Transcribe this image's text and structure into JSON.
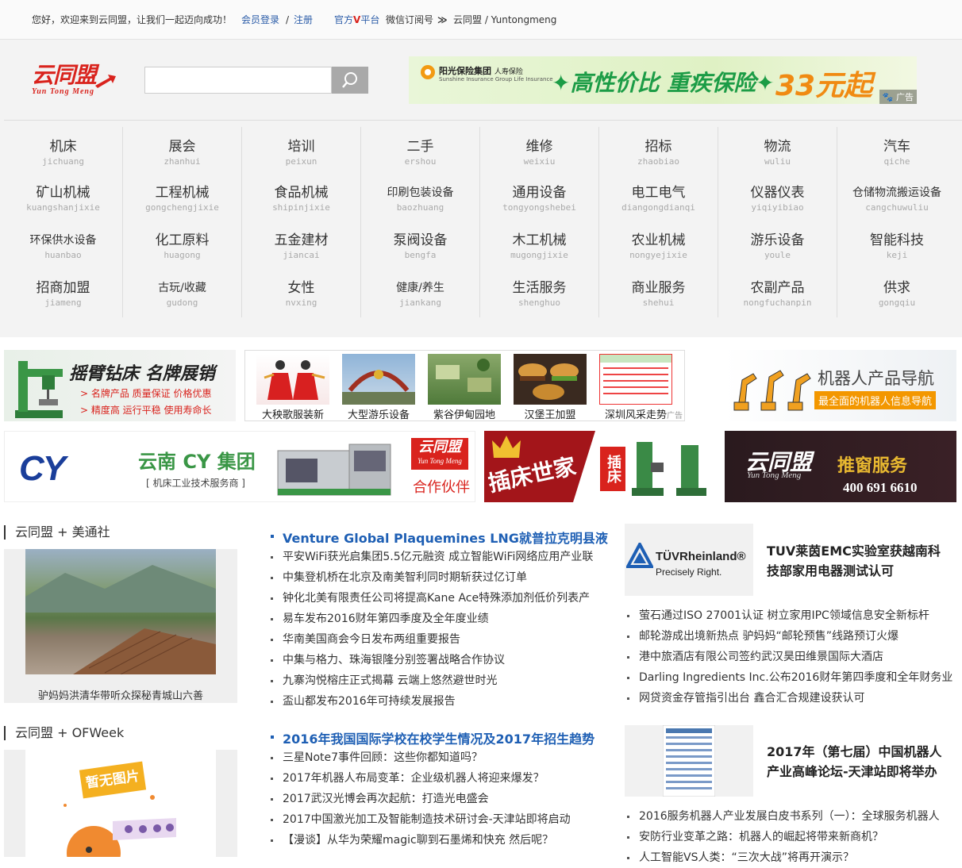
{
  "topbar": {
    "welcome": "您好，欢迎来到云同盟，让我们一起迈向成功！",
    "login": "会员登录",
    "sep": "/",
    "register": "注册",
    "official_prefix": "官方",
    "official_v": "V",
    "official_suffix": "平台",
    "wechat": "微信订阅号",
    "arrows": "≫",
    "brand": "云同盟 / Yuntongmeng"
  },
  "logo": {
    "cn": "云同盟",
    "en": "Yun Tong Meng"
  },
  "search": {
    "placeholder": "",
    "value": ""
  },
  "top_ad": {
    "company": "阳光保险集团",
    "company_sub": "人寿保险",
    "company_en": "Sunshine Insurance Group   Life Insurance",
    "slogan": "✦高性价比 重疾保险✦",
    "price": "33元起",
    "tag": "广告"
  },
  "nav": [
    [
      {
        "cn": "机床",
        "py": "jichuang"
      },
      {
        "cn": "展会",
        "py": "zhanhui"
      },
      {
        "cn": "培训",
        "py": "peixun"
      },
      {
        "cn": "二手",
        "py": "ershou"
      },
      {
        "cn": "维修",
        "py": "weixiu"
      },
      {
        "cn": "招标",
        "py": "zhaobiao"
      },
      {
        "cn": "物流",
        "py": "wuliu"
      },
      {
        "cn": "汽车",
        "py": "qiche"
      }
    ],
    [
      {
        "cn": "矿山机械",
        "py": "kuangshanjixie"
      },
      {
        "cn": "工程机械",
        "py": "gongchengjixie"
      },
      {
        "cn": "食品机械",
        "py": "shipinjixie"
      },
      {
        "cn": "印刷包装设备",
        "py": "baozhuang"
      },
      {
        "cn": "通用设备",
        "py": "tongyongshebei"
      },
      {
        "cn": "电工电气",
        "py": "diangongdianqi"
      },
      {
        "cn": "仪器仪表",
        "py": "yiqiyibiao"
      },
      {
        "cn": "仓储物流搬运设备",
        "py": "cangchuwuliu"
      }
    ],
    [
      {
        "cn": "环保供水设备",
        "py": "huanbao"
      },
      {
        "cn": "化工原料",
        "py": "huagong"
      },
      {
        "cn": "五金建材",
        "py": "jiancai"
      },
      {
        "cn": "泵阀设备",
        "py": "bengfa"
      },
      {
        "cn": "木工机械",
        "py": "mugongjixie"
      },
      {
        "cn": "农业机械",
        "py": "nongyejixie"
      },
      {
        "cn": "游乐设备",
        "py": "youle"
      },
      {
        "cn": "智能科技",
        "py": "keji"
      }
    ],
    [
      {
        "cn": "招商加盟",
        "py": "jiameng"
      },
      {
        "cn": "古玩/收藏",
        "py": "gudong"
      },
      {
        "cn": "女性",
        "py": "nvxing"
      },
      {
        "cn": "健康/养生",
        "py": "jiankang"
      },
      {
        "cn": "生活服务",
        "py": "shenghuo"
      },
      {
        "cn": "商业服务",
        "py": "shehui"
      },
      {
        "cn": "农副产品",
        "py": "nongfuchanpin"
      },
      {
        "cn": "供求",
        "py": "gongqiu"
      }
    ]
  ],
  "banners": {
    "drill": {
      "title": "摇臂钻床 名牌展销",
      "line1": "> 名牌产品  质量保证  价格优惠",
      "line2": "> 精度高  运行平稳  使用寿命长"
    },
    "thumbs": [
      {
        "cap": "大秧歌服装新"
      },
      {
        "cap": "大型游乐设备"
      },
      {
        "cap": "紫谷伊甸园地"
      },
      {
        "cap": "汉堡王加盟"
      },
      {
        "cap": "深圳风采走势"
      }
    ],
    "thumbs_ad": "广告",
    "robot": {
      "title": "机器人产品导航",
      "sub": "最全面的机器人信息导航"
    },
    "cy": {
      "logo": "CY",
      "title": "云南 CY 集团",
      "sub": "[ 机床工业技术服务商 ]",
      "badge_cn": "云同盟",
      "badge_en": "Yun Tong Meng",
      "partner": "合作伙伴"
    },
    "jcsj": {
      "title": "插床世家",
      "tag": "插床"
    },
    "service": {
      "logo_cn": "云同盟",
      "logo_en": "Yun Tong Meng",
      "title": "推窗服务",
      "phone": "400 691 6610"
    }
  },
  "left": {
    "sec1": "云同盟 + 美通社",
    "photo1_cap": "驴妈妈洪清华带听众探秘青城山六善",
    "sec2": "云同盟 + OFWeek",
    "no_image": "暂无图片"
  },
  "middle": {
    "head1": "Venture Global Plaquemines LNG就普拉克明县液",
    "list1": [
      "平安WiFi获光启集团5.5亿元融资 成立智能WiFi网络应用产业联",
      "中集登机桥在北京及南美智利同时期斩获过亿订单",
      "钟化北美有限责任公司将提高Kane Ace特殊添加剂低价列表产",
      "易车发布2016财年第四季度及全年度业绩",
      "华南美国商会今日发布两组重要报告",
      "中集与格力、珠海银隆分别签署战略合作协议",
      "九寨沟悦榕庄正式揭幕 云端上悠然避世时光",
      "盃山都发布2016年可持续发展报告"
    ],
    "head2": "2016年我国国际学校在校学生情况及2017年招生趋势",
    "list2": [
      "三星Note7事件回顾：这些你都知道吗？",
      "2017年机器人布局变革：企业级机器人将迎来爆发？",
      "2017武汉光博会再次起航：打造光电盛会",
      "2017中国激光加工及智能制造技术研讨会-天津站即将启动",
      "【漫谈】从华为荣耀magic聊到石墨烯和快充 然后呢？"
    ]
  },
  "right": {
    "tuv_name": "TÜVRheinland®",
    "tuv_slogan": "Precisely Right.",
    "feat1": "TUV莱茵EMC实验室获越南科技部家用电器测试认可",
    "list1": [
      "萤石通过ISO 27001认证 树立家用IPC领域信息安全新标杆",
      "邮轮游成出境新热点 驴妈妈“邮轮预售”线路预订火爆",
      "港中旅酒店有限公司签约武汉昊田维景国际大酒店",
      "Darling Ingredients Inc.公布2016财年第四季度和全年财务业",
      "网贷资金存管指引出台 鑫合汇合规建设获认可"
    ],
    "feat2": "2017年（第七届）中国机器人产业高峰论坛-天津站即将举办",
    "list2": [
      "2016服务机器人产业发展白皮书系列（一）：全球服务机器人",
      "安防行业变革之路：机器人的崛起将带来新商机？",
      "人工智能VS人类：“三次大战”将再开演示？"
    ]
  }
}
